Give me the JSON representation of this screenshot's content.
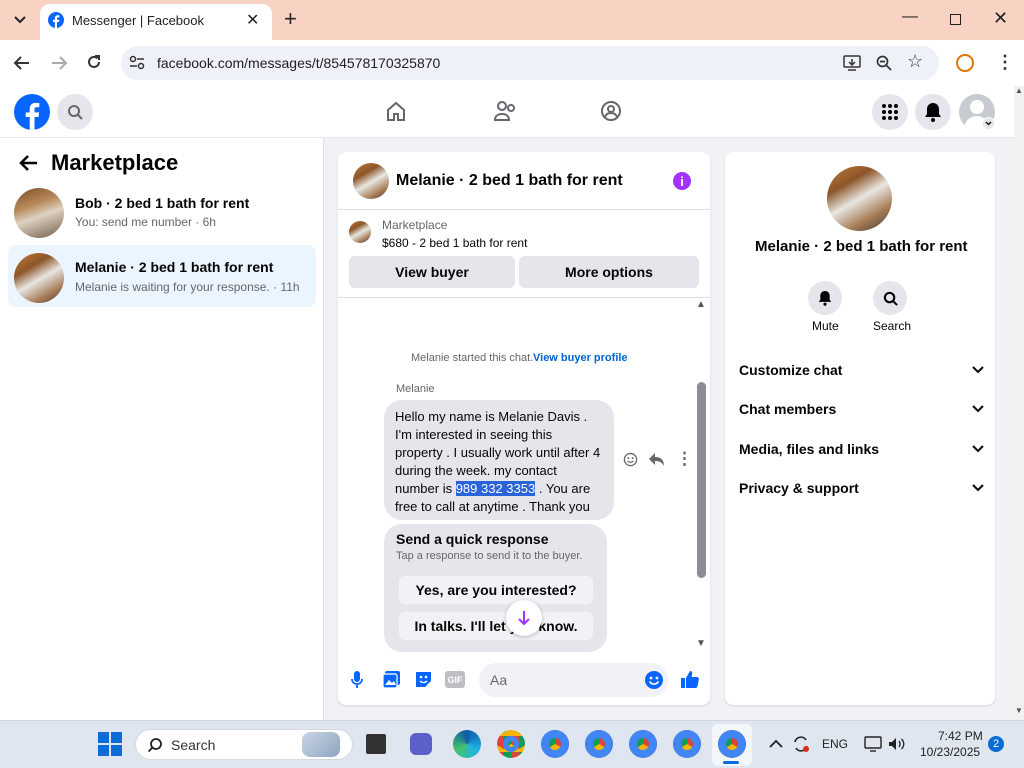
{
  "browser": {
    "tab_title": "Messenger | Facebook",
    "url": "facebook.com/messages/t/854578170325870"
  },
  "left": {
    "title": "Marketplace",
    "conversations": [
      {
        "name": "Bob · 2 bed 1 bath for rent",
        "preview": "You: send me number · 6h"
      },
      {
        "name": "Melanie · 2 bed 1 bath for rent",
        "preview": "Melanie is waiting for your response. · 11h"
      }
    ]
  },
  "chat": {
    "title": "Melanie · 2 bed 1 bath for rent",
    "listing_source": "Marketplace",
    "listing_price": "$680 - 2 bed 1 bath for rent",
    "view_buyer": "View buyer",
    "more_options": "More options",
    "started_text": "Melanie started this chat.",
    "buyer_profile_link": "View buyer profile",
    "sender": "Melanie",
    "message_before": "Hello my name is Melanie Davis . I'm interested in seeing this property . I usually work until after 4 during the week. my contact number is ",
    "message_highlight": "989 332 3353",
    "message_after": " . You are free to call at anytime . Thank you",
    "quick_title": "Send a quick response",
    "quick_sub": "Tap a response to send it to the buyer.",
    "quick_options": [
      "Yes, are you interested?",
      "In talks. I'll let you know."
    ],
    "composer_placeholder": "Aa"
  },
  "right": {
    "name": "Melanie · 2 bed 1 bath for rent",
    "mute": "Mute",
    "search": "Search",
    "sections": [
      "Customize chat",
      "Chat members",
      "Media, files and links",
      "Privacy & support"
    ]
  },
  "taskbar": {
    "search_placeholder": "Search",
    "lang": "ENG",
    "time": "7:42 PM",
    "date": "10/23/2025",
    "notif_count": "2"
  },
  "colors": {
    "brand": "#0866ff",
    "accent": "#a033ff",
    "highlight": "#2b63d9"
  }
}
